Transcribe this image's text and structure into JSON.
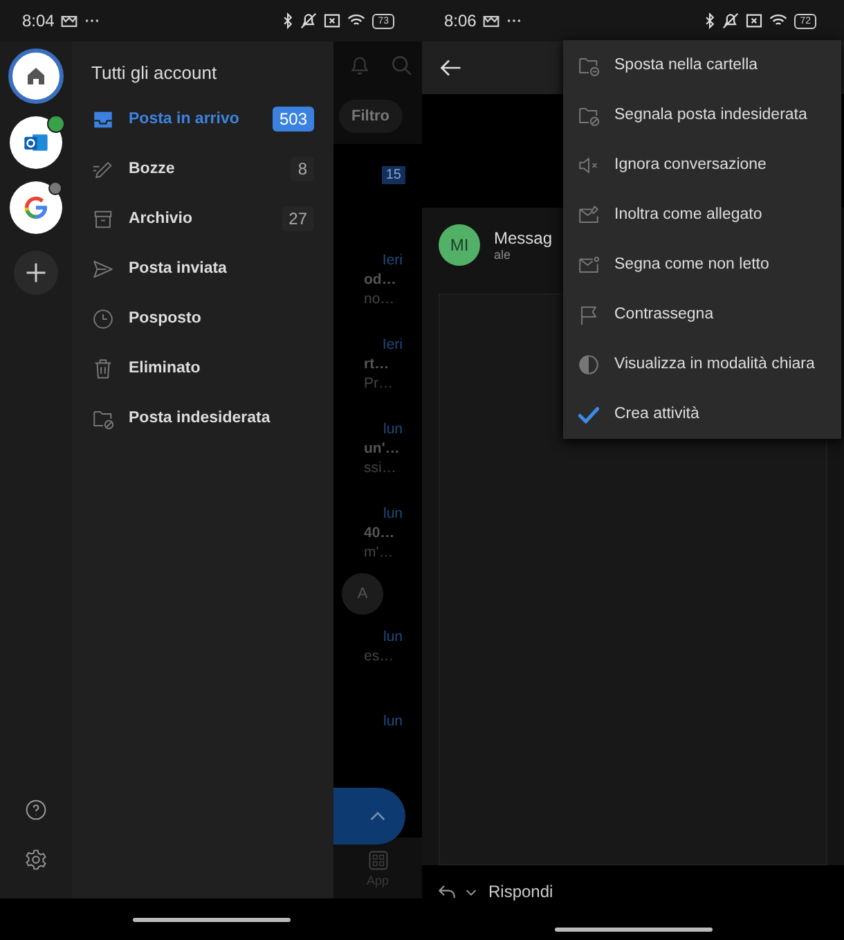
{
  "left_screen": {
    "status_bar": {
      "time": "8:04",
      "battery": "73"
    },
    "accounts": [
      {
        "kind": "home",
        "selected": true
      },
      {
        "kind": "outlook",
        "selected": false
      },
      {
        "kind": "google",
        "selected": false
      }
    ],
    "drawer": {
      "title": "Tutti gli account",
      "folders": [
        {
          "label": "Posta in arrivo",
          "count": "503",
          "selected": true
        },
        {
          "label": "Bozze",
          "count": "8",
          "selected": false
        },
        {
          "label": "Archivio",
          "count": "27",
          "selected": false
        },
        {
          "label": "Posta inviata",
          "selected": false
        },
        {
          "label": "Posposto",
          "selected": false
        },
        {
          "label": "Eliminato",
          "selected": false
        },
        {
          "label": "Posta indesiderata",
          "selected": false
        }
      ]
    },
    "background_list": {
      "filter": "Filtro",
      "badge": "15",
      "rows": [
        {
          "date": "Ieri",
          "lines": [
            "od…",
            "no…"
          ]
        },
        {
          "date": "Ieri",
          "lines": [
            "rt…",
            "Pr…"
          ]
        },
        {
          "date": "lun",
          "lines": [
            "un'…",
            "ssi…"
          ]
        },
        {
          "date": "lun",
          "lines": [
            "40…",
            "m'…"
          ]
        }
      ],
      "avatar": "A",
      "rows_after": [
        {
          "date": "lun",
          "lines": [
            "es…"
          ]
        },
        {
          "date": "lun"
        }
      ],
      "nav_label": "App"
    }
  },
  "right_screen": {
    "status_bar": {
      "time": "8:06",
      "battery": "72"
    },
    "message": {
      "avatar": "MI",
      "subject": "Messag",
      "sender": "ale"
    },
    "menu": [
      {
        "label": "Sposta nella cartella"
      },
      {
        "label": "Segnala posta indesiderata"
      },
      {
        "label": "Ignora conversazione"
      },
      {
        "label": "Inoltra come allegato"
      },
      {
        "label": "Segna come non letto"
      },
      {
        "label": "Contrassegna"
      },
      {
        "label": "Visualizza in modalità chiara"
      },
      {
        "label": "Crea attività"
      }
    ],
    "reply": "Rispondi"
  }
}
